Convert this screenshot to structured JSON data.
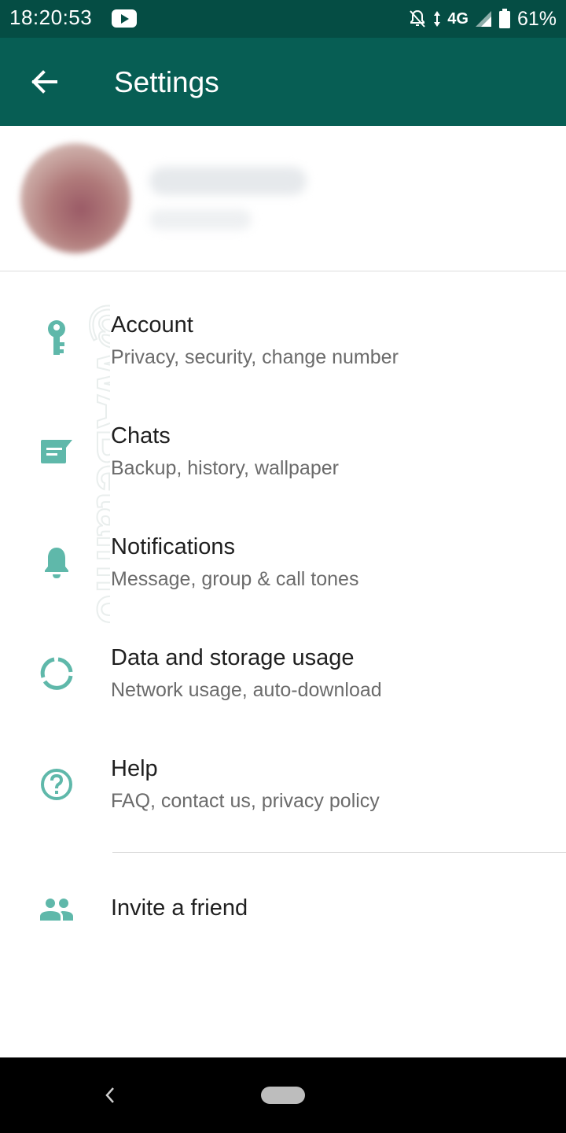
{
  "status_bar": {
    "time": "18:20:53",
    "network": "4G",
    "battery": "61%",
    "icons": [
      "youtube-icon",
      "notifications-off-icon",
      "data-arrows-icon",
      "signal-icon",
      "battery-icon"
    ]
  },
  "app_bar": {
    "title": "Settings",
    "back_icon": "arrow-back-icon"
  },
  "menu": {
    "items": [
      {
        "title": "Account",
        "subtitle": "Privacy, security, change number",
        "icon": "key-icon"
      },
      {
        "title": "Chats",
        "subtitle": "Backup, history, wallpaper",
        "icon": "chat-icon"
      },
      {
        "title": "Notifications",
        "subtitle": "Message, group & call tones",
        "icon": "bell-icon"
      },
      {
        "title": "Data and storage usage",
        "subtitle": "Network usage, auto-download",
        "icon": "data-usage-icon"
      },
      {
        "title": "Help",
        "subtitle": "FAQ, contact us, privacy policy",
        "icon": "help-icon"
      }
    ],
    "invite": {
      "title": "Invite a friend",
      "icon": "people-icon"
    }
  },
  "watermark": "@WABetaInfo",
  "colors": {
    "status_bar": "#054D44",
    "app_bar": "#075E54",
    "icon_teal": "#5FB8AA"
  }
}
